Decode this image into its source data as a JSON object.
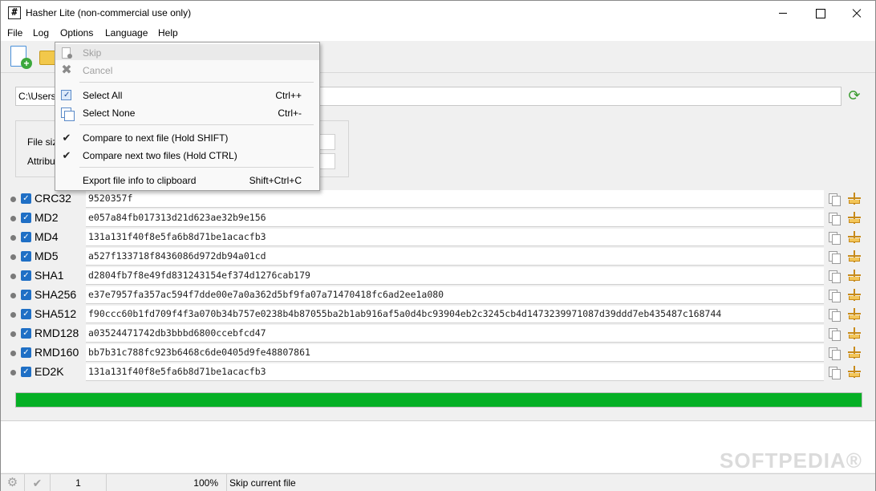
{
  "window": {
    "title": "Hasher Lite (non-commercial use only)",
    "app_icon_glyph": "#",
    "controls": [
      "minimize",
      "maximize",
      "close"
    ]
  },
  "menubar": {
    "items": [
      "File",
      "Log",
      "Options",
      "Language",
      "Help"
    ]
  },
  "toolbar": {
    "icons": [
      "new-file-icon",
      "open-folder-icon"
    ]
  },
  "path": {
    "value": "C:\\Users"
  },
  "info": {
    "file_size_label": "File siz",
    "attributes_label": "Attribu"
  },
  "hashes": [
    {
      "name": "CRC32",
      "checked": true,
      "value": "9520357f"
    },
    {
      "name": "MD2",
      "checked": true,
      "value": "e057a84fb017313d21d623ae32b9e156"
    },
    {
      "name": "MD4",
      "checked": true,
      "value": "131a131f40f8e5fa6b8d71be1acacfb3"
    },
    {
      "name": "MD5",
      "checked": true,
      "value": "a527f133718f8436086d972db94a01cd"
    },
    {
      "name": "SHA1",
      "checked": true,
      "value": "d2804fb7f8e49fd831243154ef374d1276cab179"
    },
    {
      "name": "SHA256",
      "checked": true,
      "value": "e37e7957fa357ac594f7dde00e7a0a362d5bf9fa07a71470418fc6ad2ee1a080"
    },
    {
      "name": "SHA512",
      "checked": true,
      "value": "f90ccc60b1fd709f4f3a070b34b757e0238b4b87055ba2b1ab916af5a0d4bc93904eb2c3245cb4d1473239971087d39ddd7eb435487c168744"
    },
    {
      "name": "RMD128",
      "checked": true,
      "value": "a03524471742db3bbbd6800ccebfcd47"
    },
    {
      "name": "RMD160",
      "checked": true,
      "value": "bb7b31c788fc923b6468c6de0405d9fe48807861"
    },
    {
      "name": "ED2K",
      "checked": true,
      "value": "131a131f40f8e5fa6b8d71be1acacfb3"
    }
  ],
  "progress": {
    "percent": 100,
    "color": "#06b025"
  },
  "statusbar": {
    "count": "1",
    "percent_text": "100%",
    "message": "Skip current file"
  },
  "watermark": {
    "text": "SOFTPEDIA®"
  },
  "options_menu": {
    "skip_label": "Skip",
    "cancel_label": "Cancel",
    "select_all_label": "Select All",
    "select_all_shortcut": "Ctrl++",
    "select_none_label": "Select None",
    "select_none_shortcut": "Ctrl+-",
    "compare_next_label": "Compare to next file (Hold SHIFT)",
    "compare_two_label": "Compare next two files (Hold CTRL)",
    "export_label": "Export file info to clipboard",
    "export_shortcut": "Shift+Ctrl+C"
  }
}
